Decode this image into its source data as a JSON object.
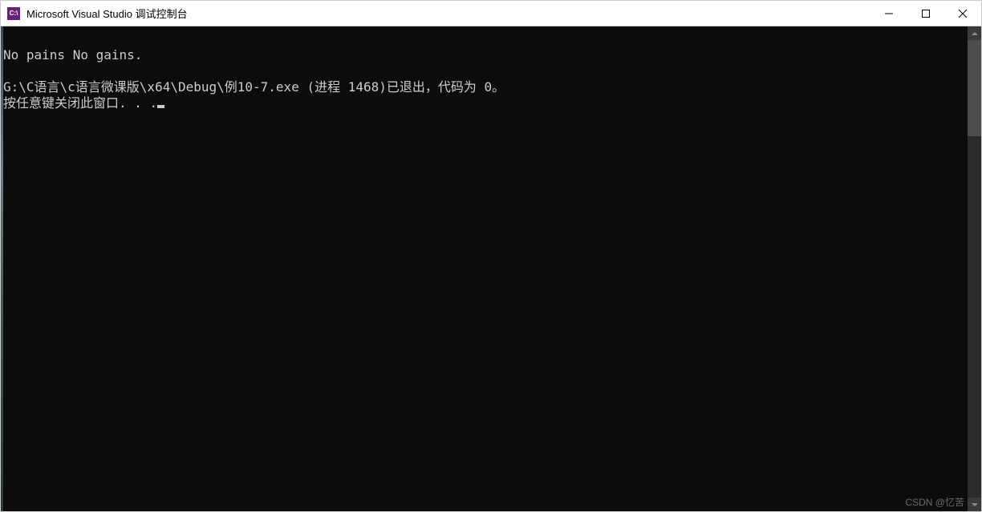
{
  "titlebar": {
    "icon_text": "C:\\",
    "title": "Microsoft Visual Studio 调试控制台"
  },
  "console": {
    "line1": "No pains No gains.",
    "line2": "",
    "line3": "G:\\C语言\\c语言微课版\\x64\\Debug\\例10-7.exe (进程 1468)已退出，代码为 0。",
    "line4": "按任意键关闭此窗口. . ."
  },
  "watermark": "CSDN @忆苦"
}
